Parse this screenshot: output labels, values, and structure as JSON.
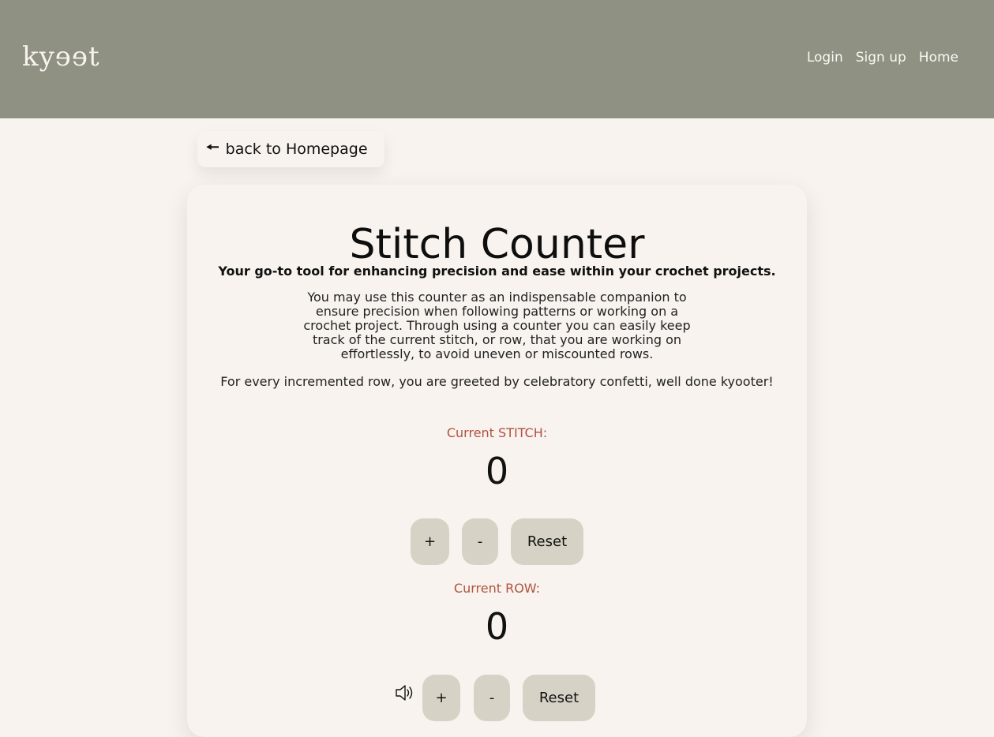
{
  "header": {
    "logo_text": "kyɘɘt",
    "nav": [
      "Login",
      "Sign up",
      "Home"
    ]
  },
  "back_button": {
    "arrow": "🠔",
    "label": "back to Homepage"
  },
  "main": {
    "title": "Stitch Counter",
    "subtitle": "Your go-to tool for enhancing precision and ease within your crochet projects.",
    "description": "You may use this counter as an indispensable companion to ensure precision when following patterns or working on a crochet project. Through using a counter you can easily keep track of the current stitch, or row, that you are working on effortlessly, to avoid uneven or miscounted rows.",
    "note": "For every incremented row, you are greeted by celebratory confetti, well done kyooter!"
  },
  "stitch_counter": {
    "label": "Current STITCH:",
    "value": "0",
    "plus": "+",
    "minus": "-",
    "reset": "Reset"
  },
  "row_counter": {
    "label": "Current ROW:",
    "value": "0",
    "plus": "+",
    "minus": "-",
    "reset": "Reset",
    "sound_icon": "speaker-icon"
  },
  "colors": {
    "header_bg": "#8f9183",
    "page_bg": "#f8f3ee",
    "accent_label": "#b0533f",
    "button_bg": "#d6d2c6"
  }
}
